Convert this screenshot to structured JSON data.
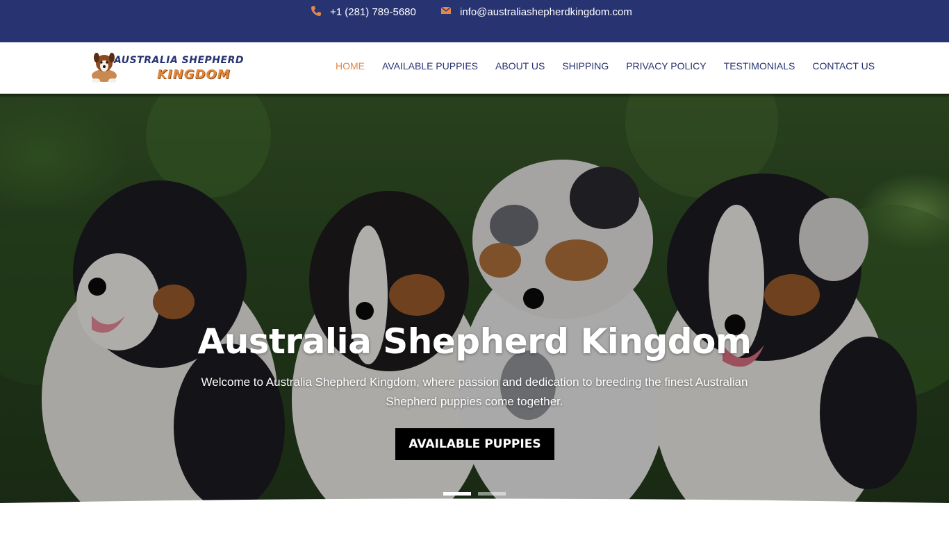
{
  "topbar": {
    "phone": "+1 (281) 789-5680",
    "email": "info@australiashepherdkingdom.com",
    "icon_color": "#e0894a",
    "background": "#283372"
  },
  "header": {
    "logo": {
      "line1": "AUSTRALIA SHEPHERD",
      "line2": "KINGDOM"
    },
    "nav": [
      {
        "label": "HOME",
        "active": true
      },
      {
        "label": "AVAILABLE PUPPIES",
        "active": false
      },
      {
        "label": "ABOUT US",
        "active": false
      },
      {
        "label": "SHIPPING",
        "active": false
      },
      {
        "label": "PRIVACY POLICY",
        "active": false
      },
      {
        "label": "TESTIMONIALS",
        "active": false
      },
      {
        "label": "CONTACT US",
        "active": false
      }
    ],
    "accent": "#e0894a",
    "nav_color": "#283372"
  },
  "hero": {
    "title": "Australia Shepherd Kingdom",
    "subtitle": "Welcome to Australia Shepherd Kingdom, where passion and dedication to breeding the finest Australian Shepherd puppies come together.",
    "button_label": "AVAILABLE PUPPIES",
    "slides": {
      "count": 2,
      "active": 1
    }
  }
}
